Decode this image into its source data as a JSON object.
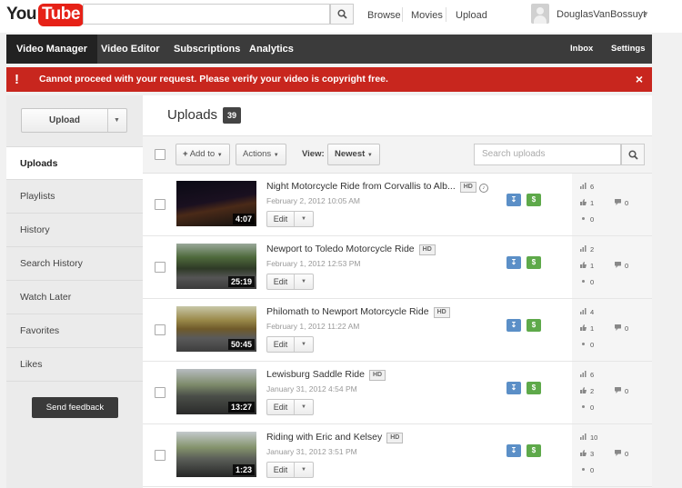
{
  "header": {
    "logo": {
      "you": "You",
      "tube": "Tube"
    },
    "links": [
      "Browse",
      "Movies",
      "Upload"
    ],
    "username": "DouglasVanBossuyt"
  },
  "nav": {
    "left_tabs": [
      "Video Manager",
      "Video Editor",
      "Subscriptions",
      "Analytics"
    ],
    "right_tabs": [
      "Inbox",
      "Settings"
    ],
    "active": "Video Manager"
  },
  "alert": {
    "icon": "!",
    "message": "Cannot proceed with your request. Please verify your video is copyright free.",
    "close": "×"
  },
  "sidebar": {
    "upload_label": "Upload",
    "items": [
      "Uploads",
      "Playlists",
      "History",
      "Search History",
      "Watch Later",
      "Favorites",
      "Likes"
    ],
    "active": "Uploads",
    "feedback_label": "Send feedback"
  },
  "main": {
    "title": "Uploads",
    "count": "39",
    "toolbar": {
      "add_to": "Add to",
      "actions": "Actions",
      "view_label": "View:",
      "view_value": "Newest",
      "search_placeholder": "Search uploads"
    },
    "videos": [
      {
        "title": "Night Motorcycle Ride from Corvallis to Alb...",
        "hd": "HD",
        "music": true,
        "date": "February 2, 2012 10:05 AM",
        "duration": "4:07",
        "views": "6",
        "likes": "1",
        "dislikes": "0",
        "comments": "0",
        "edit_label": "Edit",
        "thumb_theme": "night"
      },
      {
        "title": "Newport to Toledo Motorcycle Ride",
        "hd": "HD",
        "music": false,
        "date": "February 1, 2012 12:53 PM",
        "duration": "25:19",
        "views": "2",
        "likes": "1",
        "dislikes": "0",
        "comments": "0",
        "edit_label": "Edit",
        "thumb_theme": "forest"
      },
      {
        "title": "Philomath to Newport Motorcycle Ride",
        "hd": "HD",
        "music": false,
        "date": "February 1, 2012 11:22 AM",
        "duration": "50:45",
        "views": "4",
        "likes": "1",
        "dislikes": "0",
        "comments": "0",
        "edit_label": "Edit",
        "thumb_theme": "road"
      },
      {
        "title": "Lewisburg Saddle Ride",
        "hd": "HD",
        "music": false,
        "date": "January 31, 2012 4:54 PM",
        "duration": "13:27",
        "views": "6",
        "likes": "2",
        "dislikes": "0",
        "comments": "0",
        "edit_label": "Edit",
        "thumb_theme": "bike"
      },
      {
        "title": "Riding with Eric and Kelsey",
        "hd": "HD",
        "music": false,
        "date": "January 31, 2012 3:51 PM",
        "duration": "1:23",
        "views": "10",
        "likes": "3",
        "dislikes": "0",
        "comments": "0",
        "edit_label": "Edit",
        "thumb_theme": "bike2"
      }
    ]
  },
  "colors": {
    "alert_red": "#c8261e",
    "nav_dark": "#3b3b3b",
    "nav_active": "#222222",
    "upload_blue": "#5b8fc7",
    "monetize_green": "#5ea94a"
  },
  "icons": [
    "search-icon",
    "chevron-down-icon",
    "close-icon",
    "alert-icon",
    "upload-icon",
    "dollar-icon",
    "views-icon",
    "like-icon",
    "dislike-icon",
    "comment-icon",
    "music-icon",
    "plus-icon"
  ]
}
